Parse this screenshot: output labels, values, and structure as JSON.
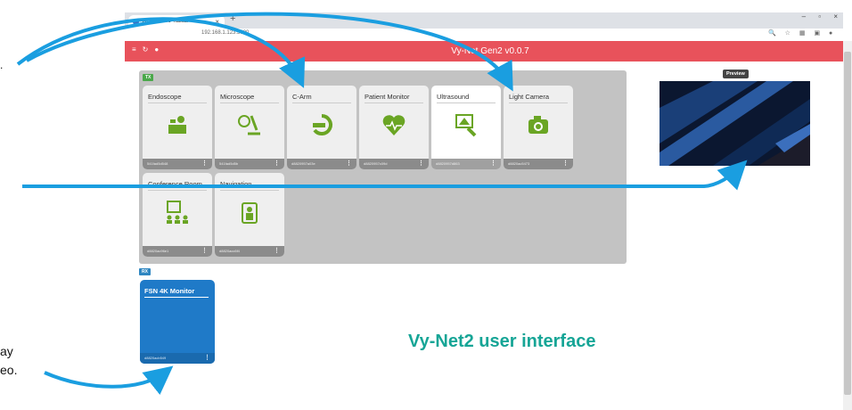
{
  "browser": {
    "tab_title": "Welcome To Yazad!",
    "tab_close": "×",
    "new_tab": "+",
    "url": "192.168.1.123:3000",
    "window_controls": "– ▫ ×"
  },
  "appbar": {
    "title": "Vy-Net Gen2 v0.0.7",
    "accent_color": "#e8525b"
  },
  "tx": {
    "badge": "TX",
    "badge_color": "#4aa84a",
    "icon_color": "#6aa524",
    "cards": [
      {
        "title": "Endoscope",
        "id": "541fad5d548",
        "icon": "endoscope-icon"
      },
      {
        "title": "Microscope",
        "id": "541fad5d5b",
        "icon": "microscope-icon"
      },
      {
        "title": "C-Arm",
        "id": "d8820957a03e",
        "icon": "c-arm-icon"
      },
      {
        "title": "Patient Monitor",
        "id": "d8820957c09d",
        "icon": "heart-monitor-icon"
      },
      {
        "title": "Ultrasound",
        "id": "d8820957d863",
        "icon": "ultrasound-icon",
        "selected": true
      },
      {
        "title": "Light Camera",
        "id": "d8820ac5473",
        "icon": "camera-icon"
      },
      {
        "title": "Conference Room",
        "id": "d8820ac96e1",
        "icon": "conference-icon"
      },
      {
        "title": "Navigation",
        "id": "d8820acc6f4",
        "icon": "navigation-icon"
      }
    ]
  },
  "rx": {
    "badge": "RX",
    "card": {
      "title": "FSN 4K Monitor",
      "id": "d8820acb549"
    }
  },
  "preview": {
    "label": "Preview"
  },
  "caption": "Vy-Net2 user interface",
  "edge_text": {
    "line1": ".",
    "line2": "ay",
    "line3": "eo."
  },
  "kebab": "⋮"
}
